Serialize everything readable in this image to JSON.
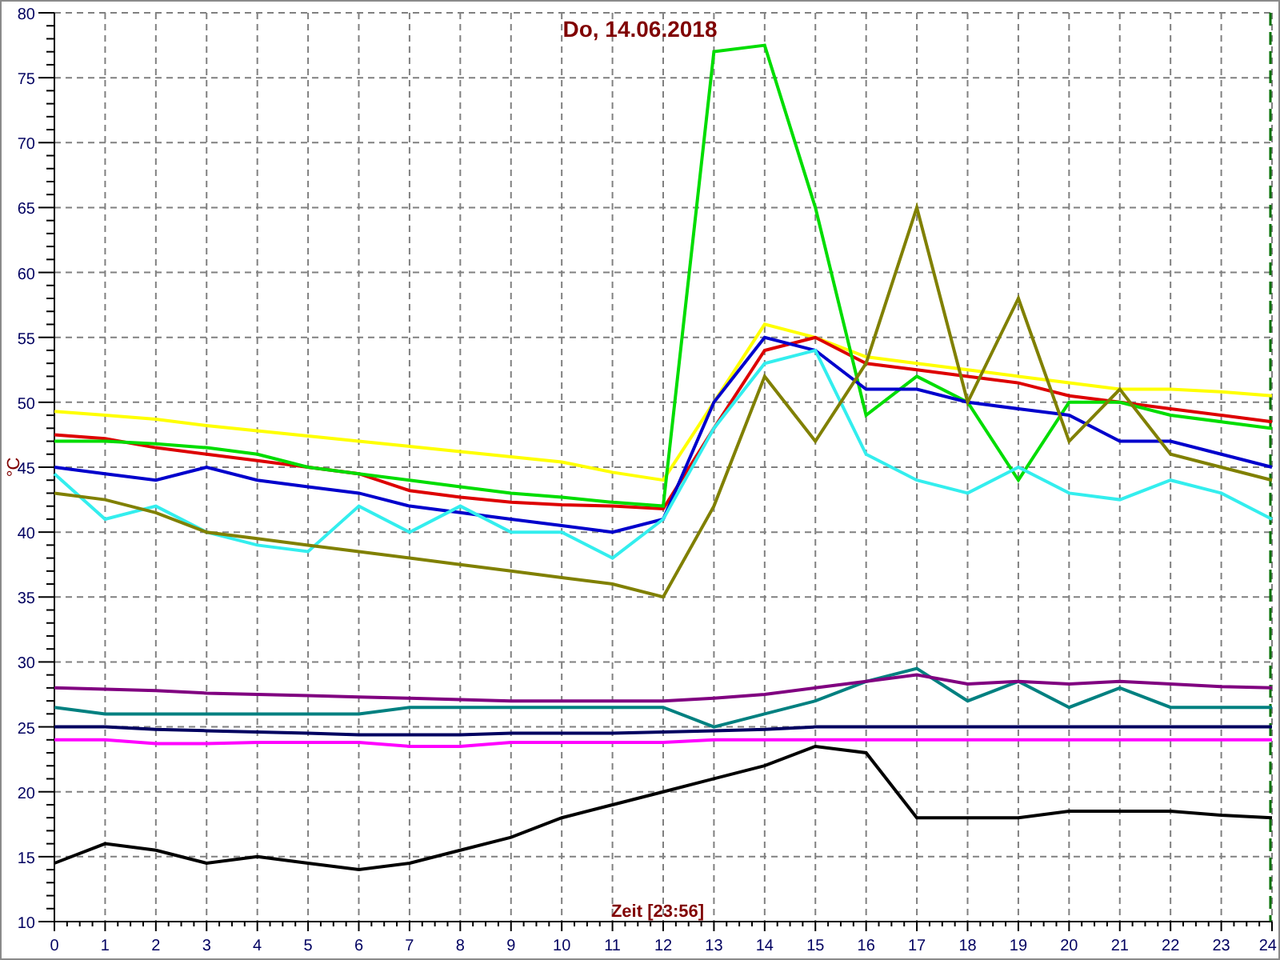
{
  "chart": {
    "chart_data": {
      "type": "line",
      "grid": true,
      "title": "Do, 14.06.2018",
      "xlabel": "Zeit [23:56]",
      "ylabel": "°C",
      "x": [
        0,
        1,
        2,
        3,
        4,
        5,
        6,
        7,
        8,
        9,
        10,
        11,
        12,
        13,
        14,
        15,
        16,
        17,
        18,
        19,
        20,
        21,
        22,
        23,
        24
      ],
      "xlim": [
        0,
        24
      ],
      "ylim": [
        10,
        80
      ],
      "xticks": [
        0,
        1,
        2,
        3,
        4,
        5,
        6,
        7,
        8,
        9,
        10,
        11,
        12,
        13,
        14,
        15,
        16,
        17,
        18,
        19,
        20,
        21,
        22,
        23,
        24
      ],
      "yticks": [
        10,
        15,
        20,
        25,
        30,
        35,
        40,
        45,
        50,
        55,
        60,
        65,
        70,
        75,
        80
      ],
      "series": [
        {
          "color": "#ffff00",
          "values": [
            49.3,
            49,
            48.7,
            48.2,
            47.8,
            47.4,
            47,
            46.6,
            46.2,
            45.8,
            45.4,
            44.6,
            44,
            50,
            56,
            55,
            53.5,
            53,
            52.5,
            52,
            51.5,
            51,
            51,
            50.8,
            50.5
          ]
        },
        {
          "color": "#dd0000",
          "values": [
            47.5,
            47.2,
            46.5,
            46,
            45.5,
            45,
            44.5,
            43.2,
            42.7,
            42.3,
            42.1,
            42,
            41.8,
            48,
            54,
            55,
            53,
            52.5,
            52,
            51.5,
            50.5,
            50,
            49.5,
            49,
            48.5
          ]
        },
        {
          "color": "#00dd00",
          "values": [
            47,
            47,
            46.8,
            46.5,
            46,
            45,
            44.5,
            44,
            43.5,
            43,
            42.7,
            42.3,
            42,
            77,
            77.5,
            65,
            49,
            52,
            50,
            44,
            50,
            50,
            49,
            48.5,
            48
          ]
        },
        {
          "color": "#0000cc",
          "values": [
            45,
            44.5,
            44,
            45,
            44,
            43.5,
            43,
            42,
            41.5,
            41,
            40.5,
            40,
            41,
            50,
            55,
            54,
            51,
            51,
            50,
            49.5,
            49,
            47,
            47,
            46,
            45
          ]
        },
        {
          "color": "#33eeee",
          "values": [
            44.5,
            41,
            42,
            40,
            39,
            38.5,
            42,
            40,
            42,
            40,
            40,
            38,
            41,
            48,
            53,
            54,
            46,
            44,
            43,
            45,
            43,
            42.5,
            44,
            43,
            41
          ]
        },
        {
          "color": "#808000",
          "values": [
            43,
            42.5,
            41.5,
            40,
            39.5,
            39,
            38.5,
            38,
            37.5,
            37,
            36.5,
            36,
            35,
            42,
            52,
            47,
            53,
            65,
            50,
            58,
            47,
            51,
            46,
            45,
            44
          ]
        },
        {
          "color": "#008080",
          "values": [
            26.5,
            26,
            26,
            26,
            26,
            26,
            26,
            26.5,
            26.5,
            26.5,
            26.5,
            26.5,
            26.5,
            25,
            26,
            27,
            28.5,
            29.5,
            27,
            28.5,
            26.5,
            28,
            26.5,
            26.5,
            26.5
          ]
        },
        {
          "color": "#800080",
          "values": [
            28,
            27.9,
            27.8,
            27.6,
            27.5,
            27.4,
            27.3,
            27.2,
            27.1,
            27,
            27,
            27,
            27,
            27.2,
            27.5,
            28,
            28.5,
            29,
            28.3,
            28.5,
            28.3,
            28.5,
            28.3,
            28.1,
            28
          ]
        },
        {
          "color": "#000060",
          "values": [
            25,
            25,
            24.8,
            24.7,
            24.6,
            24.5,
            24.4,
            24.4,
            24.4,
            24.5,
            24.5,
            24.5,
            24.6,
            24.7,
            24.8,
            25,
            25,
            25,
            25,
            25,
            25,
            25,
            25,
            25,
            25
          ]
        },
        {
          "color": "#ff00ff",
          "values": [
            24,
            24,
            23.7,
            23.7,
            23.8,
            23.8,
            23.8,
            23.5,
            23.5,
            23.8,
            23.8,
            23.8,
            23.8,
            24,
            24,
            24,
            24,
            24,
            24,
            24,
            24,
            24,
            24,
            24,
            24
          ]
        },
        {
          "color": "#000000",
          "values": [
            14.5,
            16,
            15.5,
            14.5,
            15,
            14.5,
            14,
            14.5,
            15.5,
            16.5,
            18,
            19,
            20,
            21,
            22,
            23.5,
            23,
            18,
            18,
            18,
            18.5,
            18.5,
            18.5,
            18.2,
            18
          ]
        }
      ]
    }
  }
}
